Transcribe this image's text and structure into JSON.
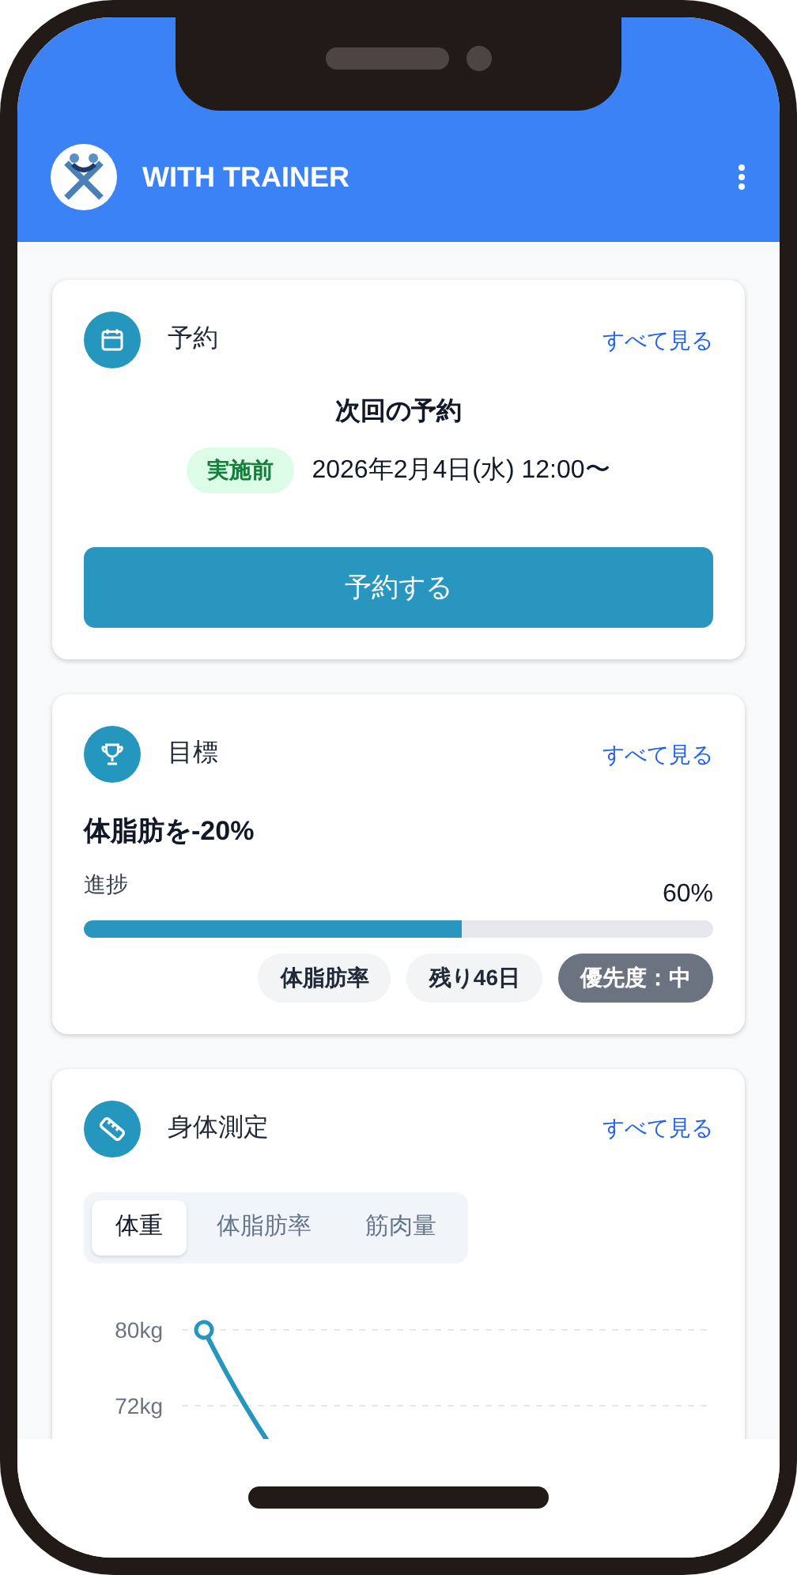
{
  "app_bar": {
    "title": "WITH TRAINER"
  },
  "reservation": {
    "title": "予約",
    "see_all": "すべて見る",
    "next_label": "次回の予約",
    "status": "実施前",
    "datetime": "2026年2月4日(水) 12:00〜",
    "button": "予約する"
  },
  "goal": {
    "title": "目標",
    "see_all": "すべて見る",
    "name": "体脂肪を-20%",
    "progress_label": "進捗",
    "progress_value": "60%",
    "level": 0.6,
    "tags": [
      {
        "label": "体脂肪率",
        "kind": "plain"
      },
      {
        "label": "残り46日",
        "kind": "plain"
      },
      {
        "label": "優先度：中",
        "kind": "priority"
      }
    ]
  },
  "measurements": {
    "title": "身体測定",
    "see_all": "すべて見る",
    "tabs": [
      {
        "label": "体重",
        "selected": true
      },
      {
        "label": "体脂肪率",
        "selected": false
      },
      {
        "label": "筋肉量",
        "selected": false
      }
    ],
    "chart": {
      "y_labels": [
        "80kg",
        "72kg"
      ]
    }
  }
}
